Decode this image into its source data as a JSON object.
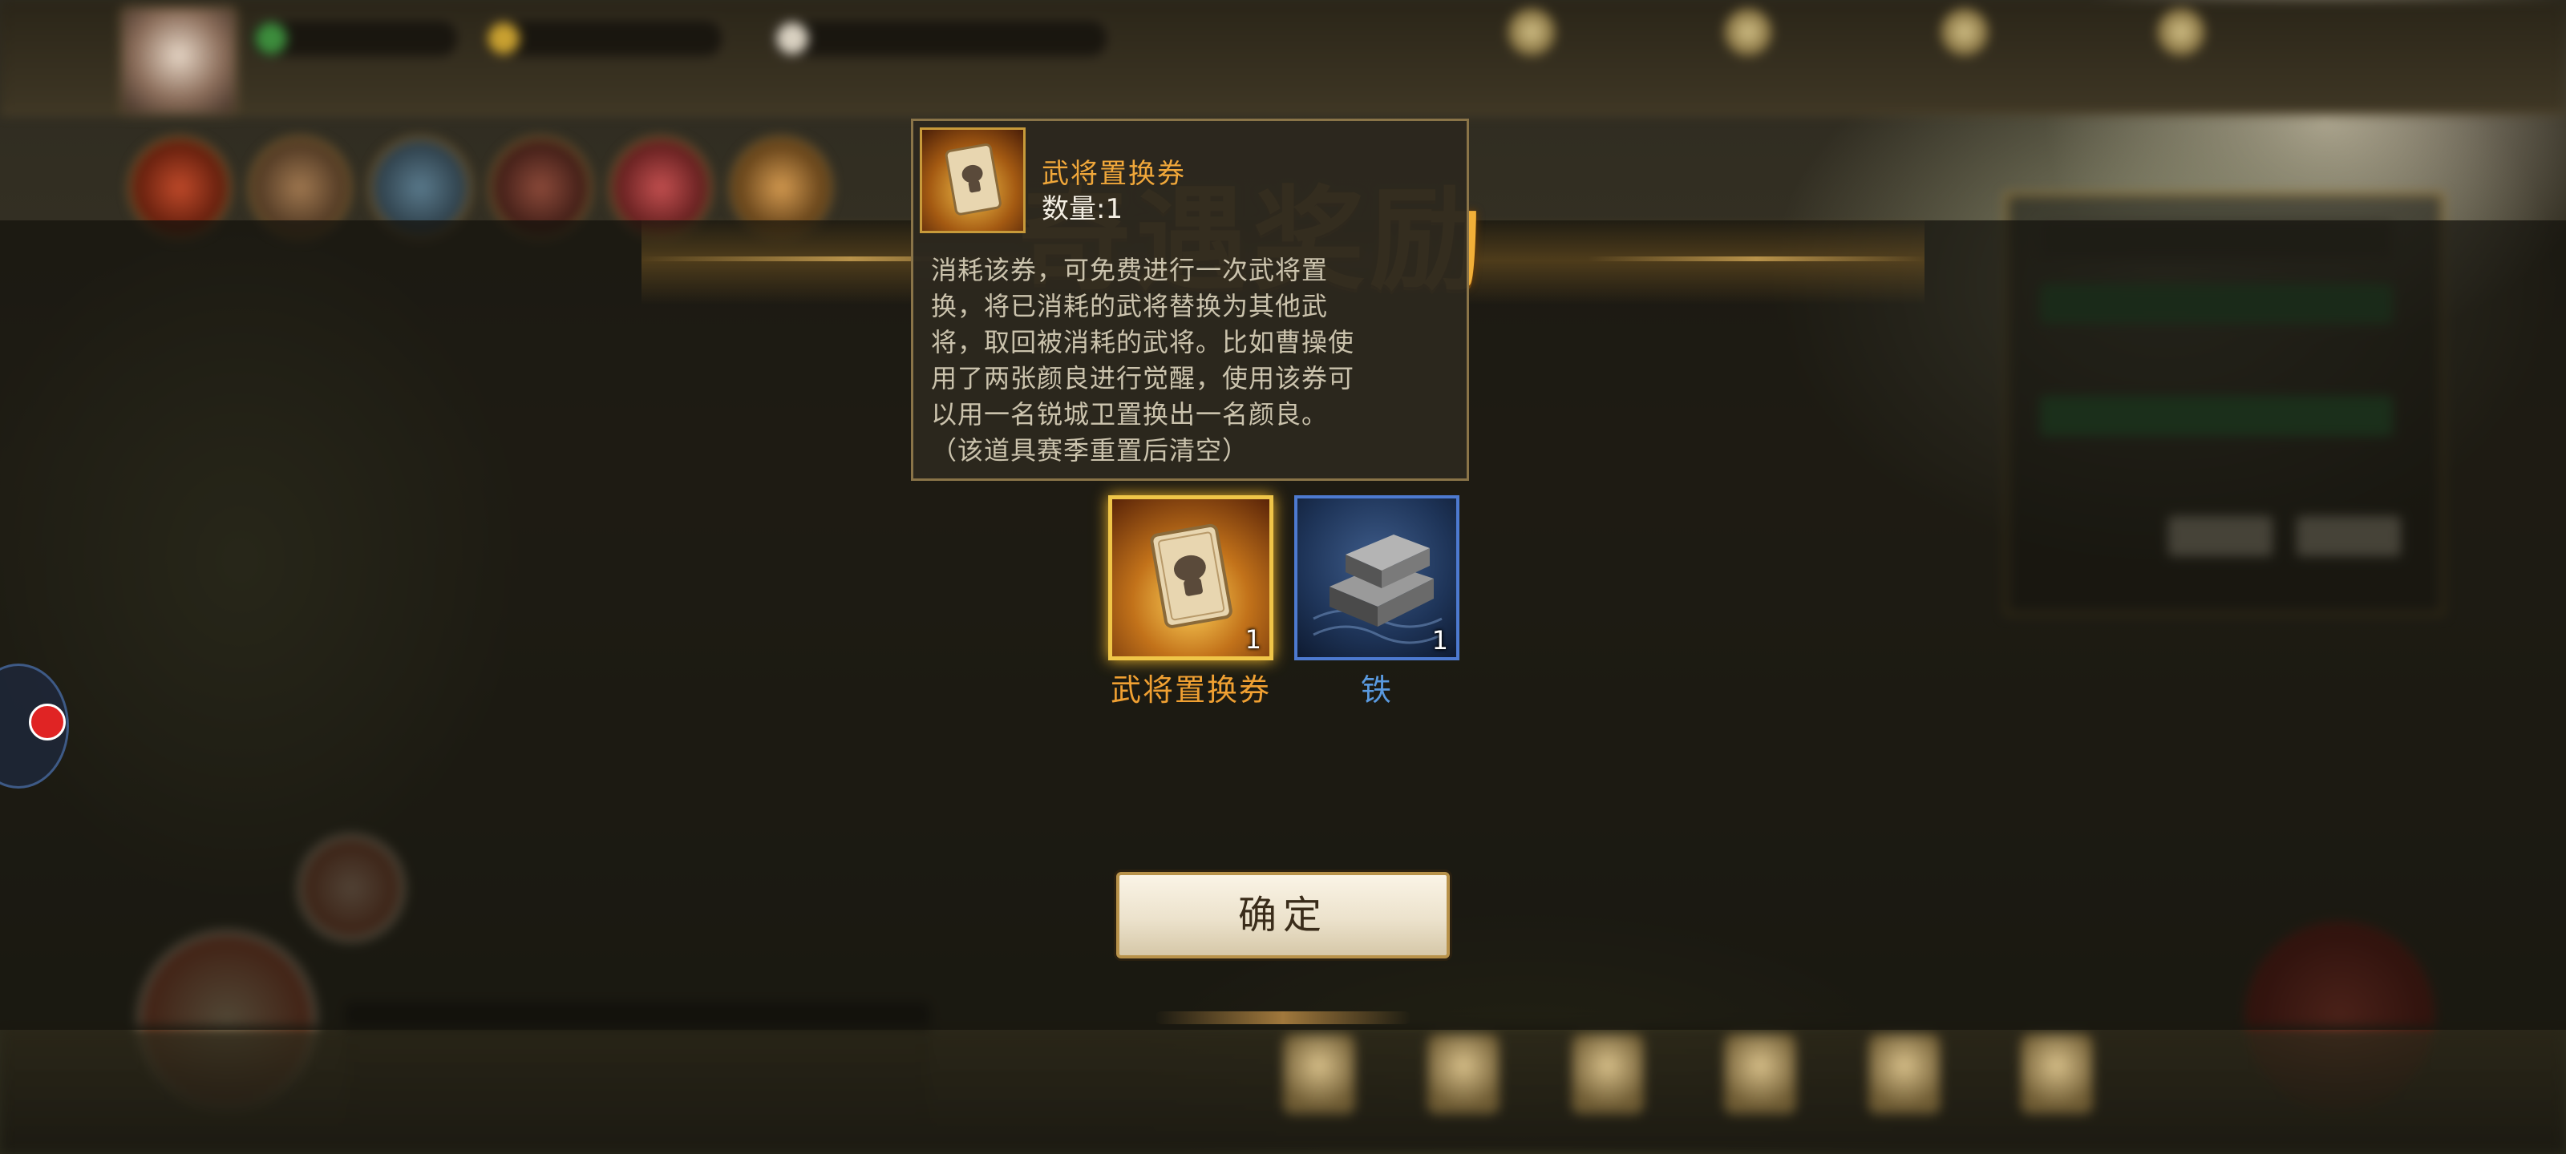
{
  "banner": {
    "title": "奇遇奖励"
  },
  "tooltip": {
    "item_name": "武将置换券",
    "quantity": "数量:1",
    "description": "消耗该券，可免费进行一次武将置\n换，将已消耗的武将替换为其他武\n将，取回被消耗的武将。比如曹操使\n用了两张颜良进行觉醒，使用该券可\n以用一名锐城卫置换出一名颜良。\n（该道具赛季重置后清空）"
  },
  "rewards": [
    {
      "name": "武将置换券",
      "count": "1",
      "rarity_color": "#f0a032",
      "icon": "general-swap-ticket-icon"
    },
    {
      "name": "铁",
      "count": "1",
      "rarity_color": "#5a9ae0",
      "icon": "iron-ingot-icon"
    }
  ],
  "confirm_button": {
    "label": "确定"
  }
}
